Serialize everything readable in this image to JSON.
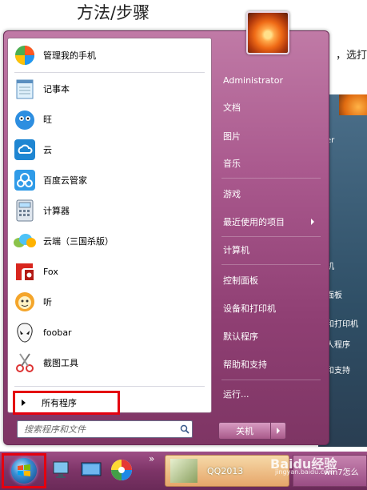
{
  "article": {
    "title": "方法/步骤",
    "side_text": "，选打"
  },
  "bg_menu": {
    "items": [
      "er",
      "机",
      "面板",
      "和打印机",
      "人程序",
      "和支持"
    ]
  },
  "left_items": [
    {
      "label": "管理我的手机",
      "icon": "phone-manager-icon"
    },
    {
      "label": "记事本",
      "icon": "notepad-icon"
    },
    {
      "label": "旺",
      "icon": "wangwang-icon"
    },
    {
      "label": "云",
      "icon": "cloud-icon"
    },
    {
      "label": "百度云管家",
      "icon": "baidu-cloud-icon"
    },
    {
      "label": "计算器",
      "icon": "calculator-icon"
    },
    {
      "label": "云端（三国杀版）",
      "icon": "yunduan-icon"
    },
    {
      "label": "Fox",
      "icon": "foxit-icon"
    },
    {
      "label": "听",
      "icon": "ting-icon"
    },
    {
      "label": "foobar",
      "icon": "foobar-icon"
    },
    {
      "label": "截图工具",
      "icon": "snipping-tool-icon"
    }
  ],
  "all_programs": "所有程序",
  "search": {
    "placeholder": "搜索程序和文件"
  },
  "right_items": [
    {
      "label": "Administrator"
    },
    {
      "label": "文档"
    },
    {
      "label": "图片"
    },
    {
      "label": "音乐"
    },
    {
      "label": "游戏"
    },
    {
      "label": "最近使用的项目",
      "arrow": true
    },
    {
      "label": "计算机"
    },
    {
      "label": "控制面板"
    },
    {
      "label": "设备和打印机"
    },
    {
      "label": "默认程序"
    },
    {
      "label": "帮助和支持"
    },
    {
      "label": "运行..."
    }
  ],
  "shutdown": {
    "label": "关机"
  },
  "taskbar": {
    "chevron": "»",
    "task1": "QQ2013",
    "task2": "win7怎么",
    "watermark": "Baidu经验",
    "watermark_sub": "jingyan.baidu.com"
  },
  "colors": {
    "menu": "#a9588d",
    "taskbar": "#7d3467",
    "highlight": "#e4000f"
  }
}
